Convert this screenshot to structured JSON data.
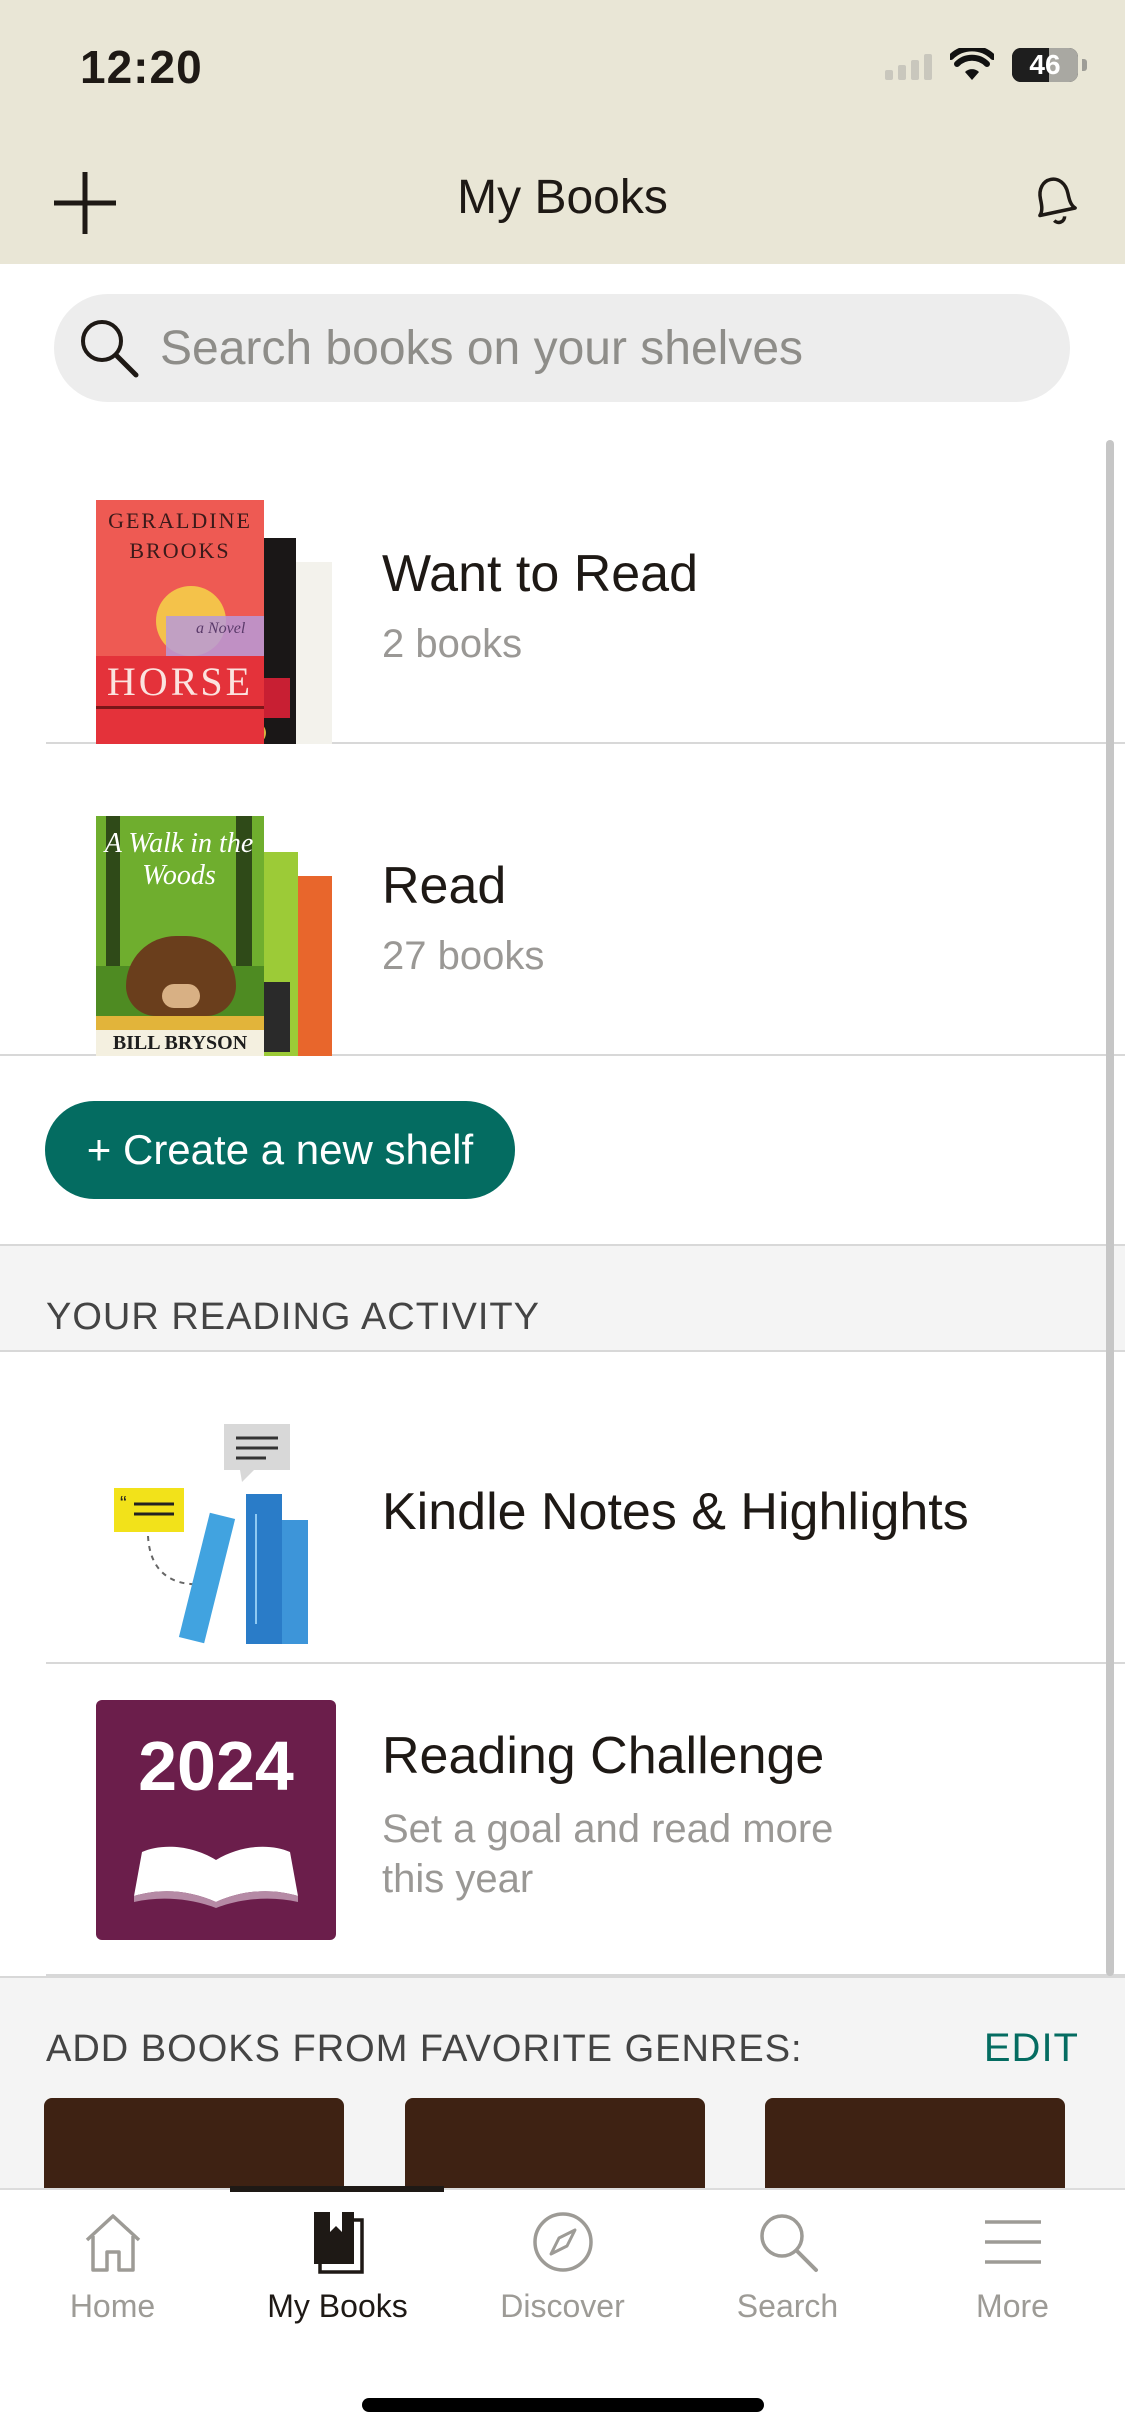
{
  "status_bar": {
    "time": "12:20",
    "battery": "46"
  },
  "nav": {
    "title": "My Books"
  },
  "search": {
    "placeholder": "Search books on your shelves"
  },
  "shelves": [
    {
      "name": "Want to Read",
      "count": "2 books",
      "cover_text": {
        "author": "GERALDINE BROOKS",
        "title": "HORSE",
        "subtitle": "a Novel"
      }
    },
    {
      "name": "Read",
      "count": "27 books",
      "cover_text": {
        "title": "A Walk in the Woods",
        "author": "BILL BRYSON"
      }
    }
  ],
  "create_shelf_label": "+ Create a new shelf",
  "reading_activity": {
    "heading": "YOUR READING ACTIVITY",
    "items": [
      {
        "title": "Kindle Notes & Highlights"
      },
      {
        "title": "Reading Challenge",
        "subtitle_line1": "Set a goal and read more",
        "subtitle_line2": "this year",
        "badge": "2024"
      }
    ]
  },
  "genres": {
    "heading": "ADD BOOKS FROM FAVORITE GENRES:",
    "edit_label": "EDIT"
  },
  "tabs": [
    {
      "label": "Home",
      "icon": "home-icon"
    },
    {
      "label": "My Books",
      "icon": "my-books-icon",
      "active": true
    },
    {
      "label": "Discover",
      "icon": "compass-icon"
    },
    {
      "label": "Search",
      "icon": "search-icon"
    },
    {
      "label": "More",
      "icon": "menu-icon"
    }
  ],
  "colors": {
    "accent": "#046c61",
    "header_bg": "#e9e6d6",
    "challenge": "#6b1e4b"
  }
}
